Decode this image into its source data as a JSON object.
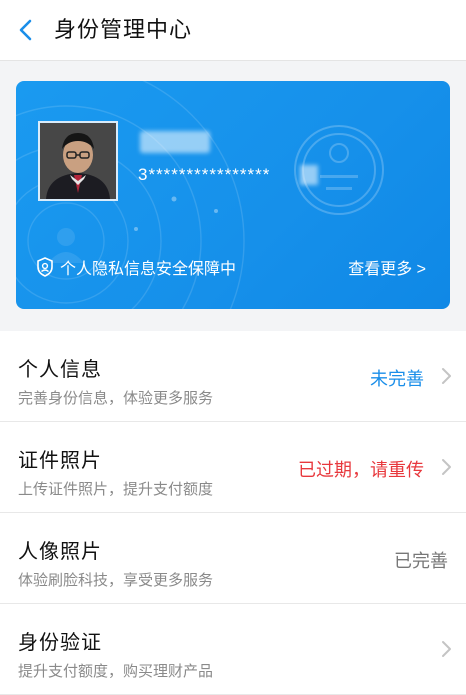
{
  "header": {
    "title": "身份管理中心"
  },
  "card": {
    "id_number": "3****************",
    "privacy_text": "个人隐私信息安全保障中",
    "more_link": "查看更多 >"
  },
  "items": [
    {
      "title": "个人信息",
      "subtitle": "完善身份信息，体验更多服务",
      "status": "未完善"
    },
    {
      "title": "证件照片",
      "subtitle": "上传证件照片，提升支付额度",
      "status": "已过期，请重传"
    },
    {
      "title": "人像照片",
      "subtitle": "体验刷脸科技，享受更多服务",
      "status": "已完善"
    },
    {
      "title": "身份验证",
      "subtitle": "提升支付额度，购买理财产品",
      "status": ""
    }
  ],
  "colors": {
    "accent": "#1a8ee9",
    "warning": "#e8383d",
    "card": "#1690ea"
  }
}
